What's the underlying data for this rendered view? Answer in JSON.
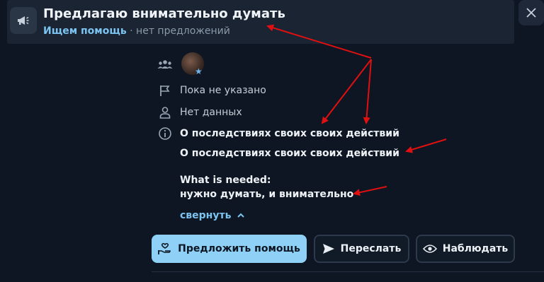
{
  "header": {
    "title": "Предлагаю внимательно думать",
    "status_link": "Ищем помощь",
    "separator": "·",
    "status_text": "нет предложений"
  },
  "details": {
    "location": "Пока не указано",
    "person": "Нет данных",
    "description_line1": "О последствиях своих своих действий",
    "description_line2": "О последствиях своих своих действий",
    "needed_label": "What is needed:",
    "needed_text": "нужно думать, и внимательно",
    "collapse_label": "свернуть"
  },
  "actions": {
    "offer_help": "Предложить помощь",
    "forward": "Переслать",
    "watch": "Наблюдать"
  },
  "colors": {
    "background": "#0d1622",
    "header_bg": "#1a2433",
    "accent": "#7cc4f2",
    "primary_button": "#8fd0f6",
    "annotation_arrow": "#e01010"
  }
}
